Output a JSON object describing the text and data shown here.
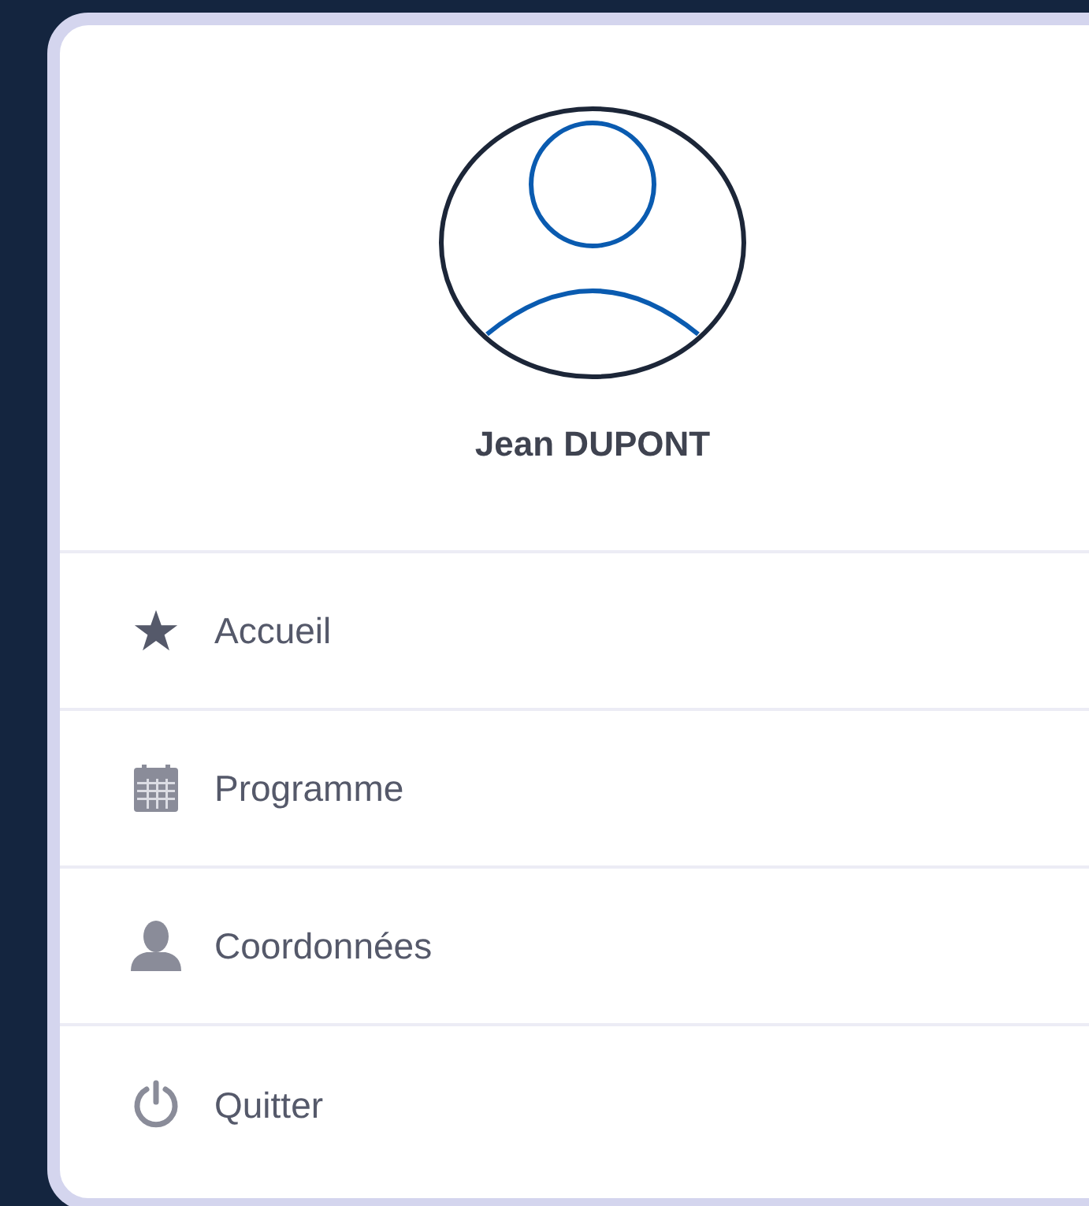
{
  "profile": {
    "name": "Jean DUPONT"
  },
  "menu": [
    {
      "kind": "star",
      "label": "Accueil"
    },
    {
      "kind": "calendar",
      "label": "Programme"
    },
    {
      "kind": "user",
      "label": "Coordonnées"
    },
    {
      "kind": "power",
      "label": "Quitter"
    }
  ]
}
